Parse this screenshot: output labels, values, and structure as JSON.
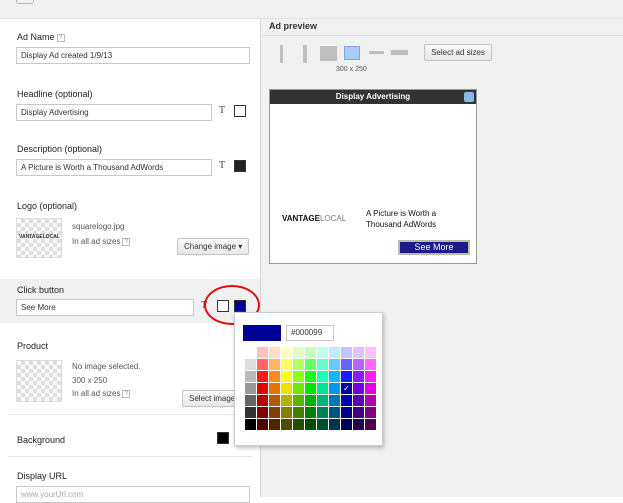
{
  "form": {
    "ad_name": {
      "label": "Ad Name",
      "value": "Display Ad created 1/9/13"
    },
    "headline": {
      "label": "Headline (optional)",
      "value": "Display Advertising"
    },
    "description": {
      "label": "Description (optional)",
      "value": "A Picture is Worth a Thousand AdWords"
    },
    "logo": {
      "label": "Logo (optional)",
      "filename": "squarelogo.jpg",
      "sizes": "In all ad sizes",
      "change_button": "Change image",
      "thumb_text": "VANTAGELOCAL"
    },
    "click_button": {
      "label": "Click button",
      "value": "See More"
    },
    "product": {
      "label": "Product",
      "status": "No image selected.",
      "dims": "300 x 250",
      "sizes": "In all ad sizes",
      "select_button": "Select image"
    },
    "background": {
      "label": "Background"
    },
    "display_url": {
      "label": "Display URL",
      "placeholder": "www.yourUrl.com"
    },
    "text_icon": "T"
  },
  "preview": {
    "title": "Ad preview",
    "selected_size": "300 x 250",
    "select_sizes_button": "Select ad sizes",
    "ad": {
      "header": "Display Advertising",
      "brand_left": "VANTAGE",
      "brand_right": "LOCAL",
      "text": "A Picture is Worth a Thousand AdWords",
      "button": "See More"
    }
  },
  "picker": {
    "hex": "#000099"
  },
  "colors": {
    "selected_button": "#000099",
    "headline_color": "#ffffff",
    "description_color": "#222222",
    "background_color": "#000000",
    "annotation": "#e01010"
  },
  "icons": {
    "help": "help-icon",
    "text_color": "text-color-icon",
    "dropdown": "dropdown-arrow-icon",
    "check": "checkmark-icon"
  }
}
